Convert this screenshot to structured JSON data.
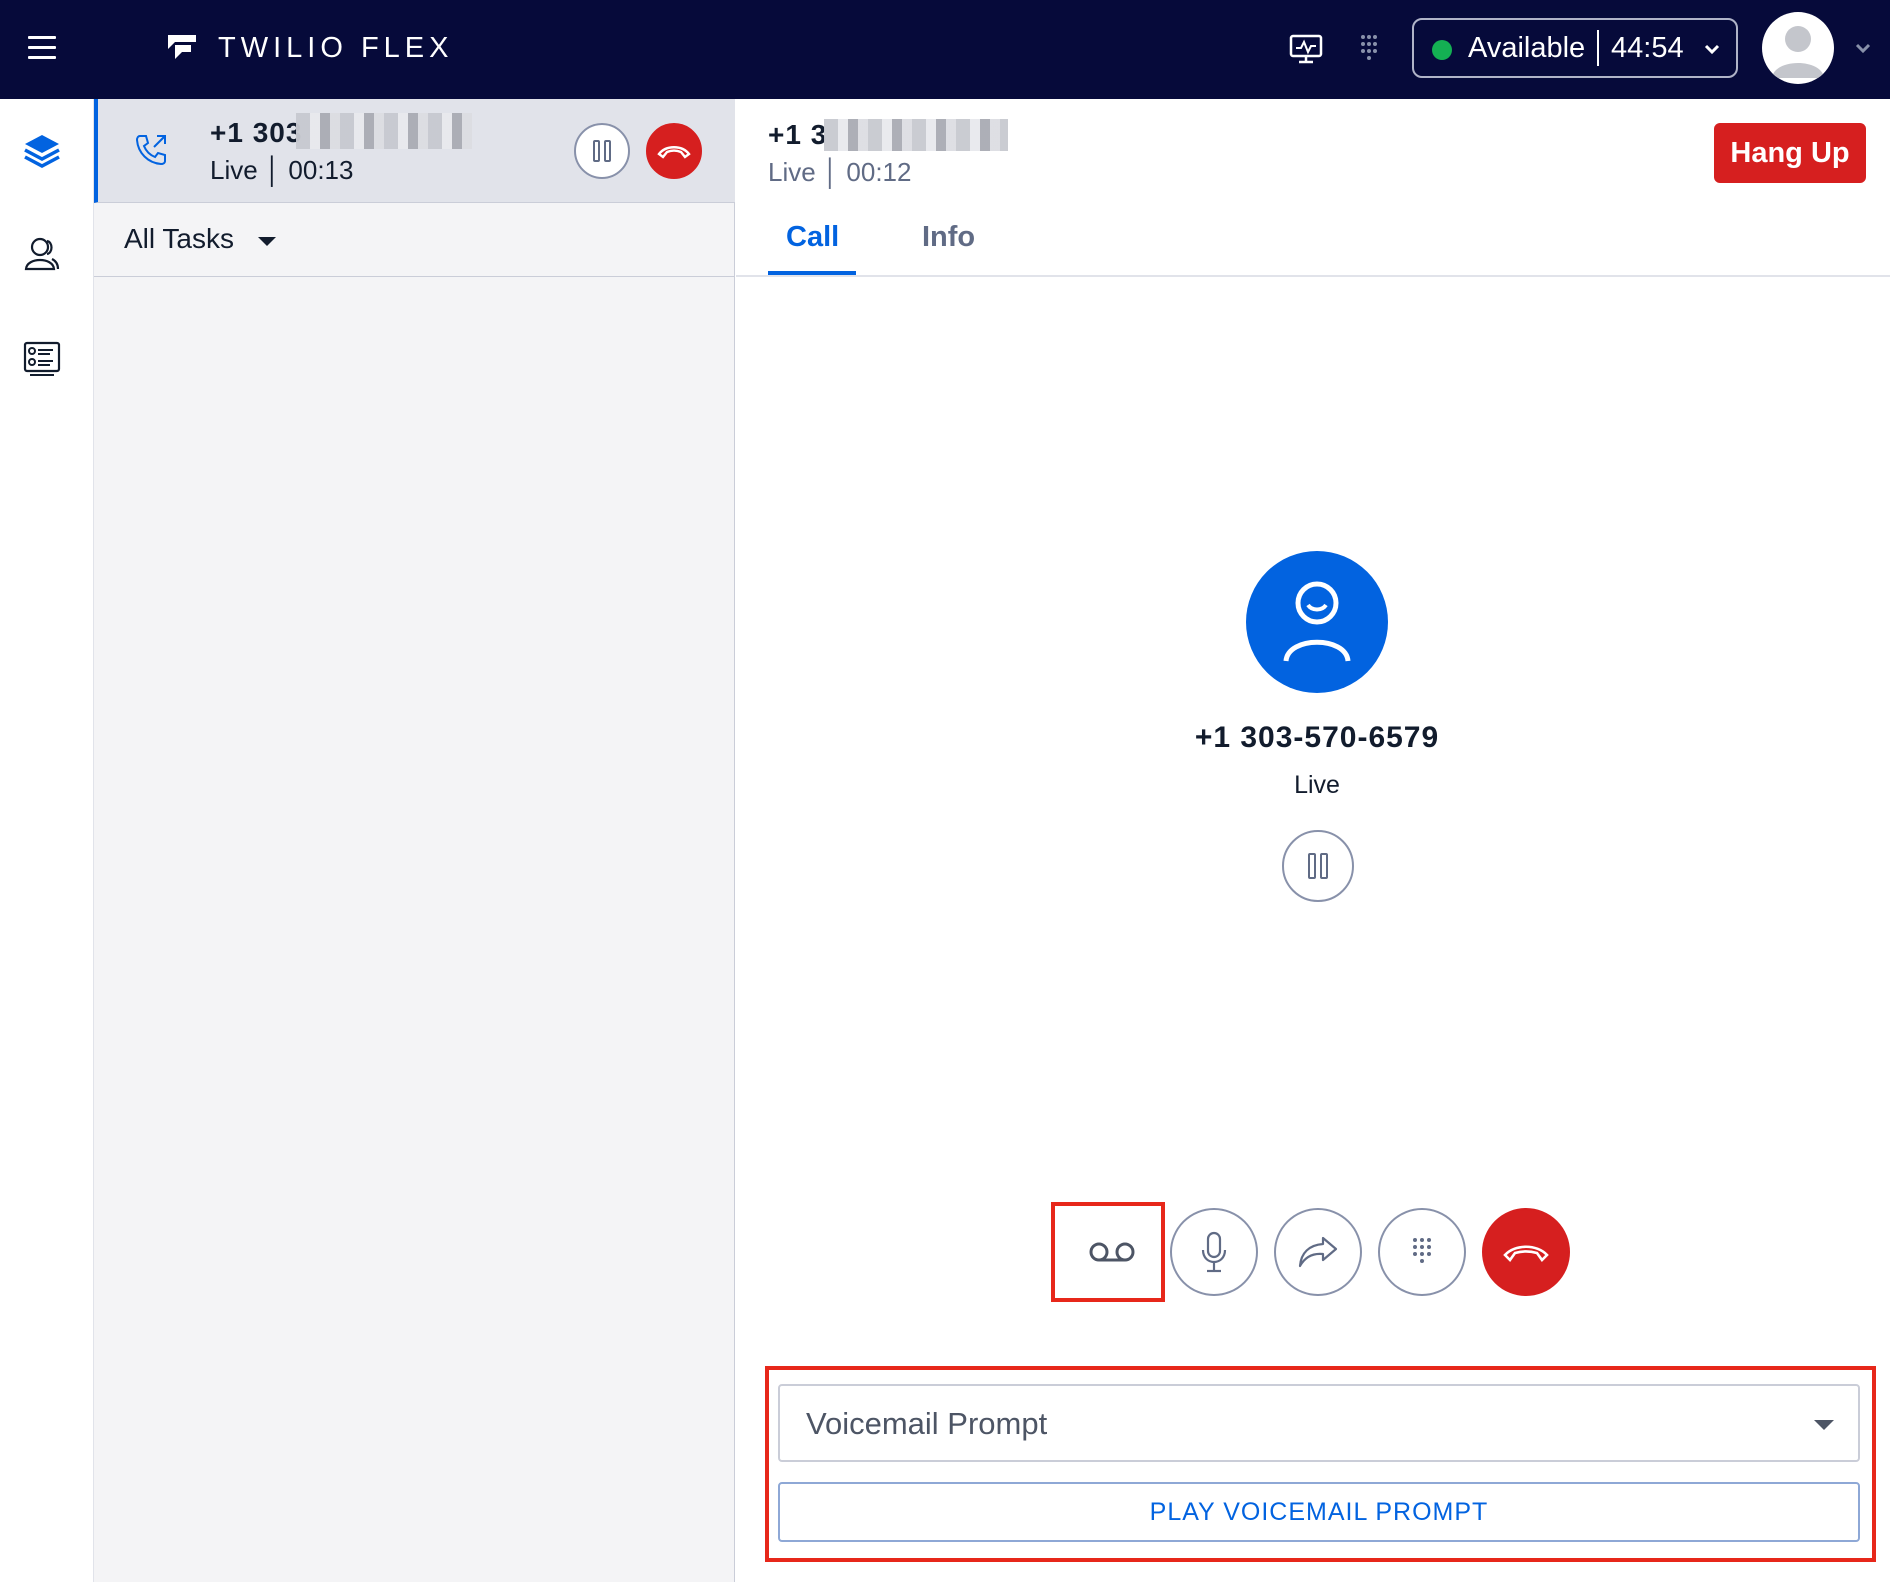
{
  "header": {
    "brand": "TWILIO FLEX",
    "status": {
      "label": "Available",
      "timer": "44:54",
      "color": "#14b053"
    }
  },
  "sidebar": {
    "items": [
      {
        "name": "agent-desktop",
        "icon": "layers-icon",
        "active": true
      },
      {
        "name": "teams",
        "icon": "users-icon",
        "active": false
      },
      {
        "name": "queues-stats",
        "icon": "task-list-icon",
        "active": false
      }
    ]
  },
  "task_list": {
    "task": {
      "number": "+1 303",
      "status": "Live",
      "timer": "00:13",
      "icon": "outbound-call-icon"
    },
    "filter": {
      "label": "All Tasks"
    }
  },
  "main": {
    "header": {
      "number": "+1 3",
      "status": "Live",
      "timer": "00:12"
    },
    "hangup_label": "Hang Up",
    "tabs": [
      {
        "label": "Call",
        "active": true
      },
      {
        "label": "Info",
        "active": false
      }
    ],
    "contact": {
      "number": "+1 303-570-6579",
      "status": "Live"
    },
    "controls": [
      {
        "name": "voicemail",
        "icon": "voicemail-icon"
      },
      {
        "name": "mute",
        "icon": "microphone-icon"
      },
      {
        "name": "transfer",
        "icon": "forward-arrow-icon"
      },
      {
        "name": "dialpad",
        "icon": "dialpad-icon"
      },
      {
        "name": "hangup",
        "icon": "phone-hangup-icon"
      }
    ],
    "voicemail": {
      "select_value": "Voicemail Prompt",
      "play_label": "PLAY VOICEMAIL PROMPT"
    }
  },
  "colors": {
    "topbar": "#060a3a",
    "accent": "#0263e0",
    "danger": "#d61f1f",
    "highlight": "#e7271a"
  }
}
